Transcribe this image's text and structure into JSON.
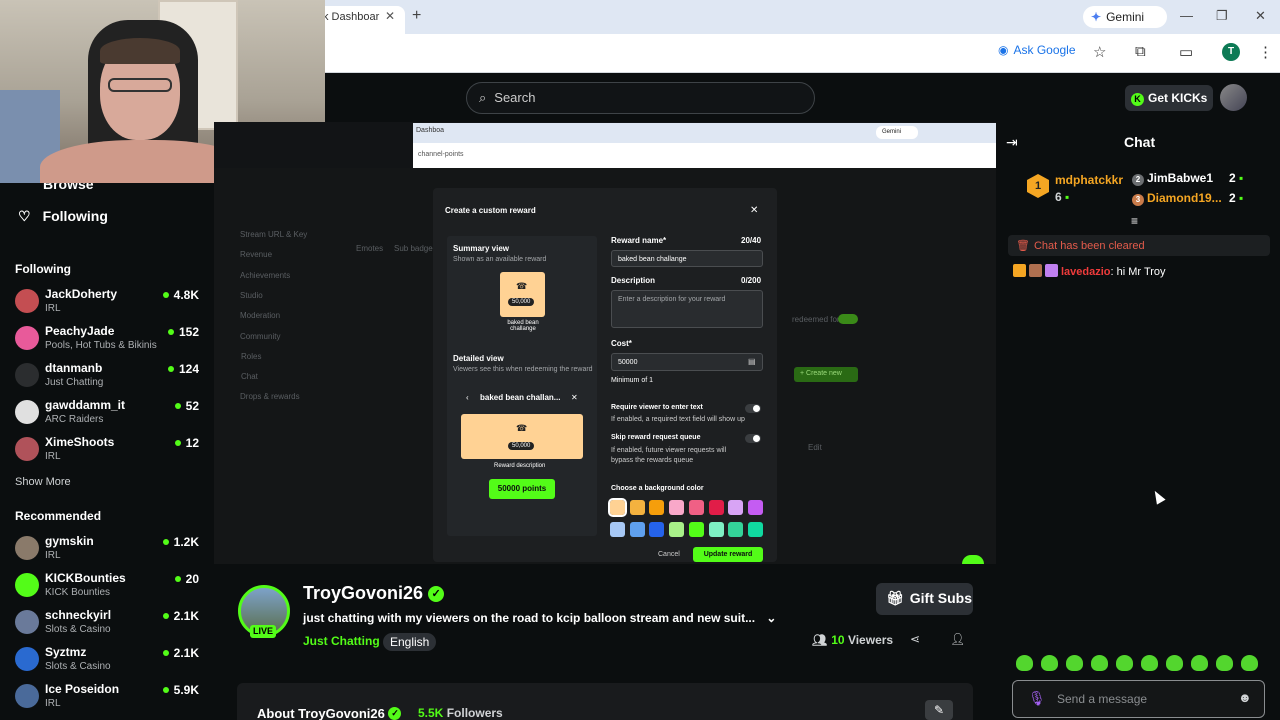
{
  "browser": {
    "tab_label": "k Dashboar",
    "gemini_label": "Gemini",
    "ask_google": "Ask Google",
    "profile_letter": "T"
  },
  "header": {
    "search_placeholder": "Search",
    "get_kicks": "Get KICKs"
  },
  "sidebar": {
    "browse": "Browse",
    "following_nav": "Following",
    "following_title": "Following",
    "following": [
      {
        "name": "JackDoherty",
        "category": "IRL",
        "viewers": "4.8K",
        "color": "#c44e52"
      },
      {
        "name": "PeachyJade",
        "category": "Pools, Hot Tubs & Bikinis",
        "viewers": "152",
        "color": "#e85a9a"
      },
      {
        "name": "dtanmanb",
        "category": "Just Chatting",
        "viewers": "124",
        "color": "#2b2d2f"
      },
      {
        "name": "gawddamm_it",
        "category": "ARC Raiders",
        "viewers": "52",
        "color": "#e0e0e0"
      },
      {
        "name": "XimeShoots",
        "category": "IRL",
        "viewers": "12",
        "color": "#b0525a"
      }
    ],
    "show_more": "Show More",
    "recommended_title": "Recommended",
    "recommended": [
      {
        "name": "gymskin",
        "category": "IRL",
        "viewers": "1.2K",
        "color": "#8a7a6a"
      },
      {
        "name": "KICKBounties",
        "category": "KICK Bounties",
        "viewers": "20",
        "color": "#53fc18"
      },
      {
        "name": "schneckyirl",
        "category": "Slots & Casino",
        "viewers": "2.1K",
        "color": "#6a7a9a"
      },
      {
        "name": "Syztmz",
        "category": "Slots & Casino",
        "viewers": "2.1K",
        "color": "#2a6ad0"
      },
      {
        "name": "Ice Poseidon",
        "category": "IRL",
        "viewers": "5.9K",
        "color": "#4a6a9a"
      }
    ]
  },
  "inner": {
    "tab": "Dashboa",
    "url": "channel-points",
    "gemini": "Gemini",
    "left_menu": [
      "Stream URL & Key",
      "Revenue",
      "Achievements",
      "Studio",
      "Moderation",
      "Community",
      "Roles",
      "Chat",
      "Drops & rewards"
    ],
    "emotes_tab": "Emotes",
    "sub_badges_tab": "Sub badge",
    "redeemed_for": "redeemed for",
    "create_new": "+ Create new",
    "edit": "Edit",
    "modal": {
      "title": "Create a custom reward",
      "summary_title": "Summary view",
      "summary_sub": "Shown as an available reward",
      "points": "50,000",
      "reward_name_small": "baked bean challange",
      "detailed_title": "Detailed view",
      "detailed_sub": "Viewers see this when redeeming the reward",
      "detailed_name": "baked bean challan...",
      "reward_description": "Reward description",
      "points_button": "50000 points",
      "reward_name_label": "Reward name*",
      "reward_name_count": "20/40",
      "reward_name_value": "baked bean challange",
      "description_label": "Description",
      "description_count": "0/200",
      "description_placeholder": "Enter a description for your reward",
      "cost_label": "Cost*",
      "cost_value": "50000",
      "minimum": "Minimum of 1",
      "require_label": "Require viewer to enter text",
      "require_sub": "If enabled, a required text field will show up",
      "skip_label": "Skip reward request queue",
      "skip_sub1": "If enabled, future viewer requests will",
      "skip_sub2": "bypass the rewards queue",
      "bg_label": "Choose a background color",
      "cancel": "Cancel",
      "update": "Update reward",
      "swatches": [
        "#ffd294",
        "#f4b23f",
        "#f59e0b",
        "#f9a8c9",
        "#f06085",
        "#e11d48",
        "#d8a4f5",
        "#c45cf2",
        "#a7c8f5",
        "#5fa0ee",
        "#2563eb",
        "#a8f089",
        "#53fc18",
        "#7ef0c4",
        "#34d399",
        "#10d9a0"
      ]
    }
  },
  "stream": {
    "live": "LIVE",
    "streamer": "TroyGovoni26",
    "title": "just chatting with my viewers on the road to kcip balloon stream and new suit...",
    "category": "Just Chatting",
    "language": "English",
    "gift_subs": "Gift Subs",
    "viewers_count": "10",
    "viewers_label": "Viewers",
    "about": "About TroyGovoni26",
    "followers_count": "5.5K",
    "followers_label": "Followers"
  },
  "chat": {
    "title": "Chat",
    "leaderboard": [
      {
        "rank": "1",
        "name": "mdphatckkr",
        "count": "6",
        "color": "#f5a623"
      },
      {
        "rank": "2",
        "name": "JimBabwe1",
        "count": "2",
        "color": "#ffffff"
      },
      {
        "rank": "3",
        "name": "Diamond19...",
        "count": "2",
        "color": "#f5a623"
      }
    ],
    "cleared": "Chat has been cleared",
    "message_user": "lavedazio",
    "message_text": ": hi Mr Troy",
    "placeholder": "Send a message"
  }
}
